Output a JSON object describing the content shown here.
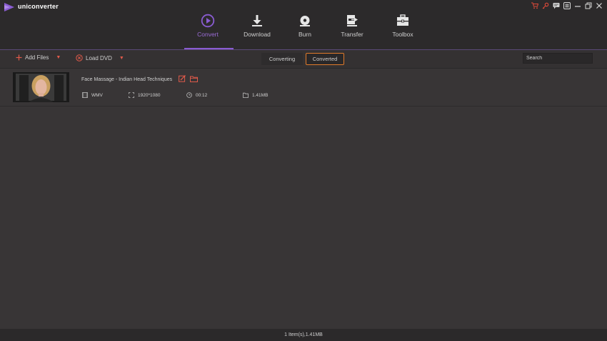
{
  "app": {
    "title": "uniconverter"
  },
  "nav": {
    "convert": "Convert",
    "download": "Download",
    "burn": "Burn",
    "transfer": "Transfer",
    "toolbox": "Toolbox",
    "active": "Convert"
  },
  "toolbar": {
    "add_files": "Add Files",
    "load_dvd": "Load DVD",
    "tab_converting": "Converting",
    "tab_converted": "Converted",
    "search_placeholder": "Search"
  },
  "files": [
    {
      "title": "Face Massage - Indian Head Techniques",
      "format": "WMV",
      "resolution": "1920*1080",
      "duration": "00:12",
      "size": "1.41MB"
    }
  ],
  "status": {
    "summary": "1 Item(s),1.41MB"
  },
  "colors": {
    "accent": "#8a5cd2",
    "highlight_border": "#e07a2a",
    "icon_red": "#e05a4a",
    "background": "#383536"
  },
  "icons": {
    "window": [
      "cart-icon",
      "key-icon",
      "chat-icon",
      "menu-icon",
      "minimize-icon",
      "restore-icon",
      "close-icon"
    ],
    "nav": [
      "play-circle-icon",
      "download-icon",
      "disc-icon",
      "transfer-icon",
      "toolbox-icon"
    ]
  }
}
